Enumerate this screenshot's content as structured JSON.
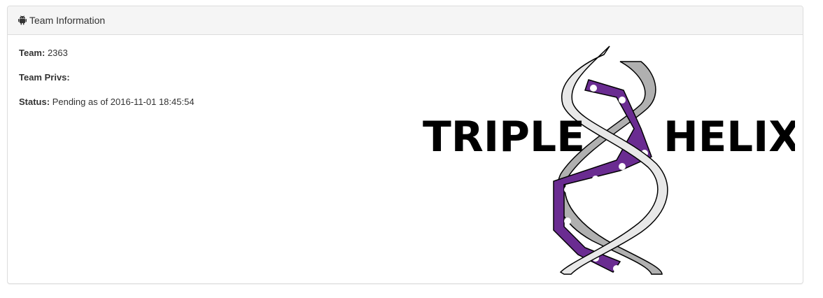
{
  "panel": {
    "title": "Team Information",
    "title_icon": "android-icon"
  },
  "info": {
    "team_label": "Team:",
    "team_value": "2363",
    "privs_label": "Team Privs:",
    "privs_value": "",
    "status_label": "Status:",
    "status_value": "Pending as of 2016-11-01 18:45:54"
  },
  "logo": {
    "word_left": "TRIPLE",
    "word_right": "HELIX",
    "accent_color": "#6a2c91",
    "ribbon_light": "#e8e8e8",
    "ribbon_dark": "#b0b0b0"
  }
}
